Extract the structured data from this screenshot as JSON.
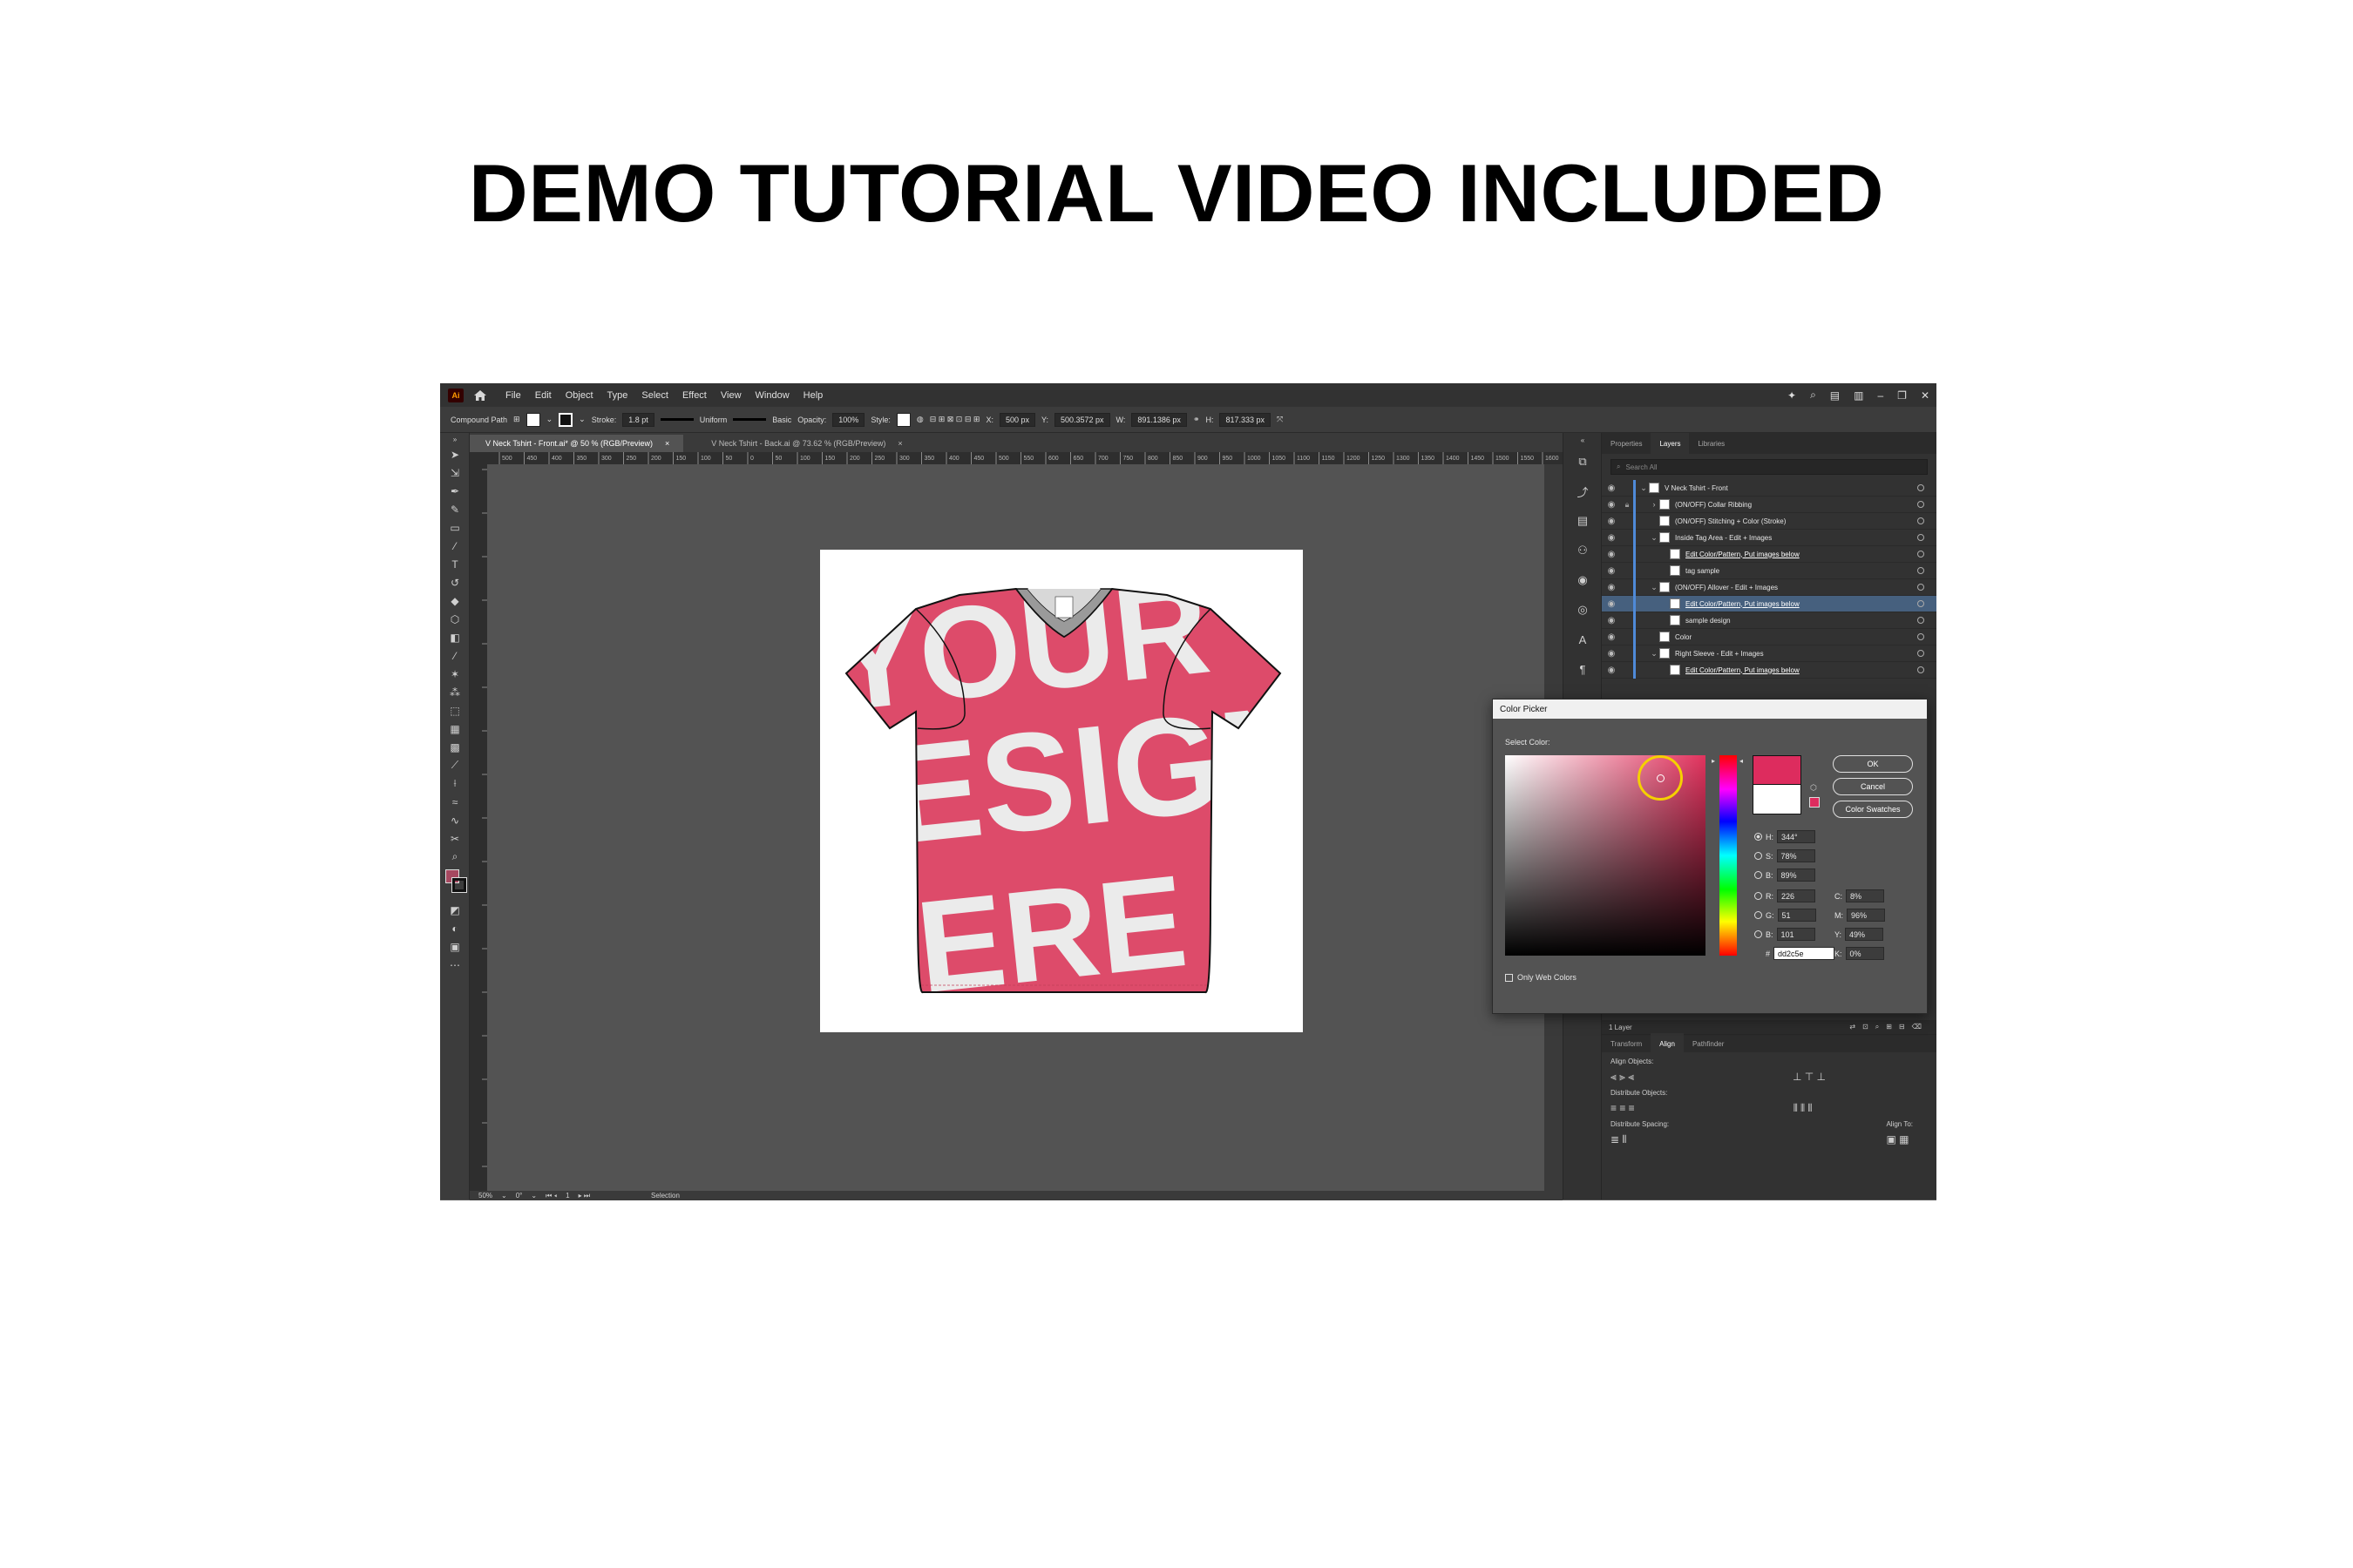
{
  "headline": "DEMO TUTORIAL VIDEO INCLUDED",
  "app": {
    "logo": "Ai",
    "menu": [
      "File",
      "Edit",
      "Object",
      "Type",
      "Select",
      "Effect",
      "View",
      "Window",
      "Help"
    ],
    "control_bar": {
      "object_type": "Compound Path",
      "stroke_label": "Stroke:",
      "stroke_value": "1.8 pt",
      "profile": "Uniform",
      "brush": "Basic",
      "opacity_label": "Opacity:",
      "opacity_value": "100%",
      "style_label": "Style:",
      "x_label": "X:",
      "x_value": "500 px",
      "y_label": "Y:",
      "y_value": "500.3572 px",
      "w_label": "W:",
      "w_value": "891.1386 px",
      "h_label": "H:",
      "h_value": "817.333 px"
    },
    "tabs": [
      {
        "label": "V Neck Tshirt - Front.ai* @ 50 % (RGB/Preview)",
        "close": "×"
      },
      {
        "label": "V Neck Tshirt - Back.ai @ 73.62 % (RGB/Preview)",
        "close": "×"
      }
    ],
    "ruler_ticks": [
      "500",
      "450",
      "400",
      "350",
      "300",
      "250",
      "200",
      "150",
      "100",
      "50",
      "0",
      "50",
      "100",
      "150",
      "200",
      "250",
      "300",
      "350",
      "400",
      "450",
      "500",
      "550",
      "600",
      "650",
      "700",
      "750",
      "800",
      "850",
      "900",
      "950",
      "1000",
      "1050",
      "1100",
      "1150",
      "1200",
      "1250",
      "1300",
      "1350",
      "1400",
      "1450",
      "1500",
      "1550",
      "1600",
      "1650"
    ],
    "status": {
      "zoom": "50%",
      "rotation": "0°",
      "artboard": "1",
      "tool": "Selection"
    },
    "artwork": {
      "print_text": [
        "YOUR",
        "DESIGN",
        "HERE"
      ],
      "shirt_color": "#ebebeb",
      "print_color": "#dd4b6a"
    }
  },
  "layers_panel": {
    "tabs": [
      "Properties",
      "Layers",
      "Libraries"
    ],
    "search_placeholder": "Search All",
    "rows": [
      {
        "name": "V Neck Tshirt - Front",
        "twirl": "⌄",
        "indent": 0,
        "link": false,
        "selected": false
      },
      {
        "name": "(ON/OFF) Collar Ribbing",
        "twirl": "›",
        "indent": 1,
        "link": false,
        "selected": false
      },
      {
        "name": "(ON/OFF) Stitching + Color (Stroke)",
        "twirl": "",
        "indent": 1,
        "link": false,
        "selected": false
      },
      {
        "name": "Inside Tag Area - Edit + Images",
        "twirl": "⌄",
        "indent": 1,
        "link": false,
        "selected": false
      },
      {
        "name": "Edit Color/Pattern, Put images below",
        "twirl": "",
        "indent": 2,
        "link": true,
        "selected": false
      },
      {
        "name": "tag sample",
        "twirl": "",
        "indent": 2,
        "link": false,
        "selected": false
      },
      {
        "name": "(ON/OFF) Allover - Edit + Images",
        "twirl": "⌄",
        "indent": 1,
        "link": false,
        "selected": false
      },
      {
        "name": "Edit Color/Pattern, Put images below",
        "twirl": "",
        "indent": 2,
        "link": true,
        "selected": true
      },
      {
        "name": "sample design",
        "twirl": "",
        "indent": 2,
        "link": false,
        "selected": false
      },
      {
        "name": "Color",
        "twirl": "",
        "indent": 1,
        "link": false,
        "selected": false
      },
      {
        "name": "Right Sleeve - Edit + Images",
        "twirl": "⌄",
        "indent": 1,
        "link": false,
        "selected": false
      },
      {
        "name": "Edit Color/Pattern, Put images below",
        "twirl": "",
        "indent": 2,
        "link": true,
        "selected": false
      }
    ],
    "footer": "1 Layer"
  },
  "align_panel": {
    "tabs": [
      "Transform",
      "Align",
      "Pathfinder"
    ],
    "align_objects": "Align Objects:",
    "distribute_objects": "Distribute Objects:",
    "distribute_spacing": "Distribute Spacing:",
    "align_to": "Align To:"
  },
  "color_picker": {
    "title": "Color Picker",
    "select_label": "Select Color:",
    "buttons": {
      "ok": "OK",
      "cancel": "Cancel",
      "swatches": "Color Swatches"
    },
    "hsb": [
      {
        "label": "H:",
        "value": "344°"
      },
      {
        "label": "S:",
        "value": "78%"
      },
      {
        "label": "B:",
        "value": "89%"
      }
    ],
    "rgb": [
      {
        "label": "R:",
        "value": "226"
      },
      {
        "label": "G:",
        "value": "51"
      },
      {
        "label": "B:",
        "value": "101"
      }
    ],
    "cmyk": [
      {
        "label": "C:",
        "value": "8%"
      },
      {
        "label": "M:",
        "value": "96%"
      },
      {
        "label": "Y:",
        "value": "49%"
      },
      {
        "label": "K:",
        "value": "0%"
      }
    ],
    "hex_label": "#",
    "hex": "dd2c5e",
    "web_only": "Only Web Colors",
    "current_color": "#dd2c5e"
  }
}
